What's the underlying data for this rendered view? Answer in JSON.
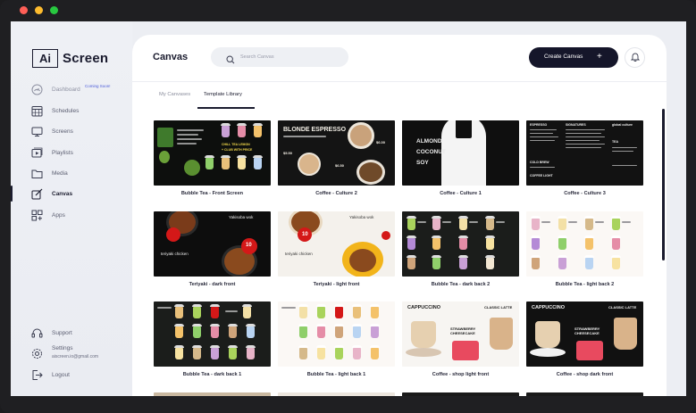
{
  "window": {
    "dots": [
      "#ff5f57",
      "#febc2e",
      "#28c840"
    ]
  },
  "brand": {
    "box": "Ai",
    "name": "Screen"
  },
  "nav": {
    "dashboard": "Dashboard",
    "coming_soon": "Coming Soon!",
    "schedules": "Schedules",
    "screens": "Screens",
    "playlists": "Playlists",
    "media": "Media",
    "canvas": "Canvas",
    "apps": "Apps",
    "support": "Support",
    "settings": "Settings",
    "settings_email": "aiscreen.io@gmail.com",
    "logout": "Logout"
  },
  "header": {
    "title": "Canvas",
    "search_placeholder": "Search Canvas",
    "create_label": "Create Canvas",
    "create_icon": "+"
  },
  "tabs": {
    "my_canvases": "My Canvases",
    "template_library": "Template Library"
  },
  "templates": [
    {
      "caption": "Bubble Tea - Front Screen",
      "texts": [
        "CHILL TEA LEMON",
        "+ CLUB WITH PRICE"
      ]
    },
    {
      "caption": "Coffee - Culture 2",
      "texts": [
        "BLONDE ESPRESSO",
        "$6.00",
        "$5.50",
        "$6.50"
      ]
    },
    {
      "caption": "Coffee - Culture 1",
      "texts": [
        "ALMOND",
        "COCONUT",
        "SOY"
      ]
    },
    {
      "caption": "Coffee - Culture 3",
      "texts": [
        "ESPRESSO",
        "SIGNATURES",
        "COLD BREW",
        "COFFEE LIGHT",
        "TEA",
        "global culture"
      ]
    },
    {
      "caption": "Teriyaki - dark front",
      "texts": [
        "Yakisoba wok",
        "teriyaki chicken",
        "10"
      ]
    },
    {
      "caption": "Teriyaki - light front",
      "texts": [
        "Yakisoba wok",
        "teriyaki chicken",
        "10"
      ]
    },
    {
      "caption": "Bubble Tea - dark back 2",
      "texts": []
    },
    {
      "caption": "Bubble Tea - light back 2",
      "texts": []
    },
    {
      "caption": "Bubble Tea - dark back 1",
      "texts": []
    },
    {
      "caption": "Bubble Tea - light back 1",
      "texts": []
    },
    {
      "caption": "Coffee - shop light front",
      "texts": [
        "CAPPUCCINO",
        "CLASSIC LATTE",
        "STRAWBERRY CHEESECAKE"
      ]
    },
    {
      "caption": "Coffee - shop dark front",
      "texts": [
        "CAPPUCCINO",
        "CLASSIC LATTE",
        "STRAWBERRY CHEESECAKE"
      ]
    }
  ]
}
